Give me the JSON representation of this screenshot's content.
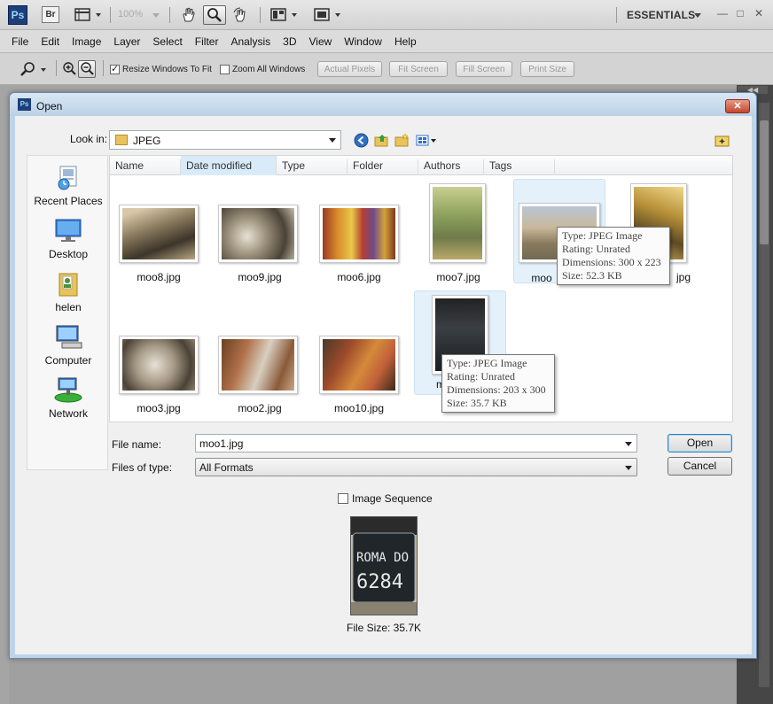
{
  "appbar": {
    "ps_logo": "Ps",
    "br_logo": "Br",
    "zoom_level": "100%",
    "workspace": "ESSENTIALS",
    "icons": [
      "launch-bridge-icon",
      "view-extras-icon",
      "zoom-level-icon",
      "hand-tool-icon",
      "zoom-tool-icon",
      "rotate-view-icon",
      "arrange-documents-icon",
      "screen-mode-icon"
    ]
  },
  "menubar": {
    "items": [
      "File",
      "Edit",
      "Image",
      "Layer",
      "Select",
      "Filter",
      "Analysis",
      "3D",
      "View",
      "Window",
      "Help"
    ]
  },
  "options": {
    "resize_windows": "Resize Windows To Fit",
    "zoom_all": "Zoom All Windows",
    "actual_pixels": "Actual Pixels",
    "fit_screen": "Fit Screen",
    "fill_screen": "Fill Screen",
    "print_size": "Print Size"
  },
  "dialog": {
    "title": "Open",
    "look_in_label": "Look in:",
    "look_in_value": "JPEG",
    "places": [
      {
        "label": "Recent Places"
      },
      {
        "label": "Desktop"
      },
      {
        "label": "helen"
      },
      {
        "label": "Computer"
      },
      {
        "label": "Network"
      }
    ],
    "columns": [
      "Name",
      "Date modified",
      "Type",
      "Folder",
      "Authors",
      "Tags"
    ],
    "files": [
      {
        "name": "moo8.jpg"
      },
      {
        "name": "moo9.jpg"
      },
      {
        "name": "moo6.jpg"
      },
      {
        "name": "moo7.jpg"
      },
      {
        "name": "moo"
      },
      {
        "name": "jpg"
      },
      {
        "name": "moo3.jpg"
      },
      {
        "name": "moo2.jpg"
      },
      {
        "name": "moo10.jpg"
      },
      {
        "name": "m"
      }
    ],
    "tooltip1": {
      "type": "Type: JPEG Image",
      "rating": "Rating: Unrated",
      "dimensions": "Dimensions: 300 x 223",
      "size": "Size: 52.3 KB"
    },
    "tooltip2": {
      "type": "Type: JPEG Image",
      "rating": "Rating: Unrated",
      "dimensions": "Dimensions: 203 x 300",
      "size": "Size: 35.7 KB"
    },
    "file_name_label": "File name:",
    "file_name_value": "moo1.jpg",
    "file_type_label": "Files of type:",
    "file_type_value": "All Formats",
    "open_button": "Open",
    "cancel_button": "Cancel",
    "image_sequence": "Image Sequence",
    "preview_text_top": "ROMA DO",
    "preview_text_bottom": "6284",
    "file_size": "File Size: 35.7K"
  }
}
